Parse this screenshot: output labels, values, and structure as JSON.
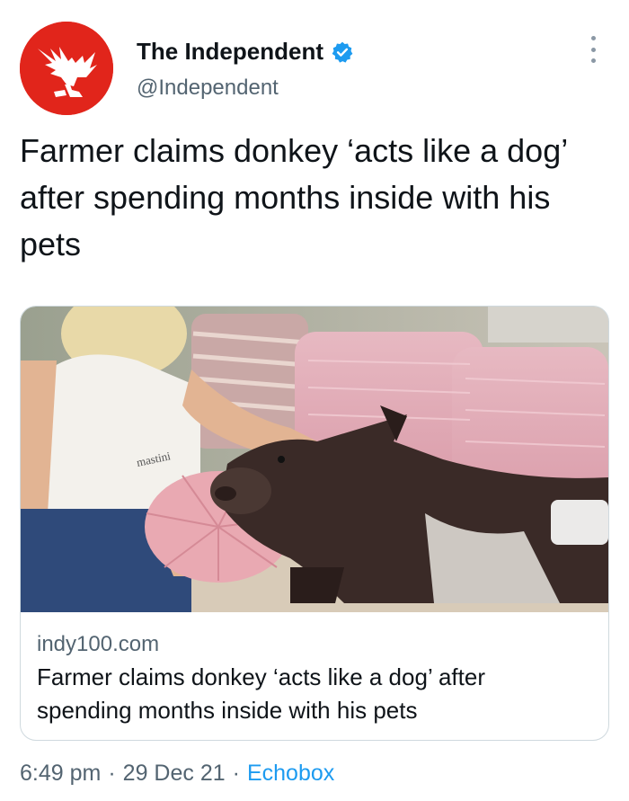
{
  "author": {
    "display_name": "The Independent",
    "handle": "@Independent",
    "verified_icon": "verified-badge-icon",
    "avatar_icon": "eagle-logo-icon",
    "brand_color": "#e1251b"
  },
  "tweet": {
    "text": "Farmer claims donkey ‘acts like a dog’ after spending months inside with his pets"
  },
  "card": {
    "image_icon": "donkey-photo",
    "shirt_text": "mastini",
    "domain": "indy100.com",
    "title": "Farmer claims donkey ‘acts like a dog’ after spending months inside with his pets"
  },
  "meta": {
    "time": "6:49 pm",
    "date": "29 Dec 21",
    "source": "Echobox",
    "separator": "·"
  },
  "colors": {
    "link": "#1d9bf0",
    "secondary_text": "#536471",
    "border": "#cfd9de"
  }
}
